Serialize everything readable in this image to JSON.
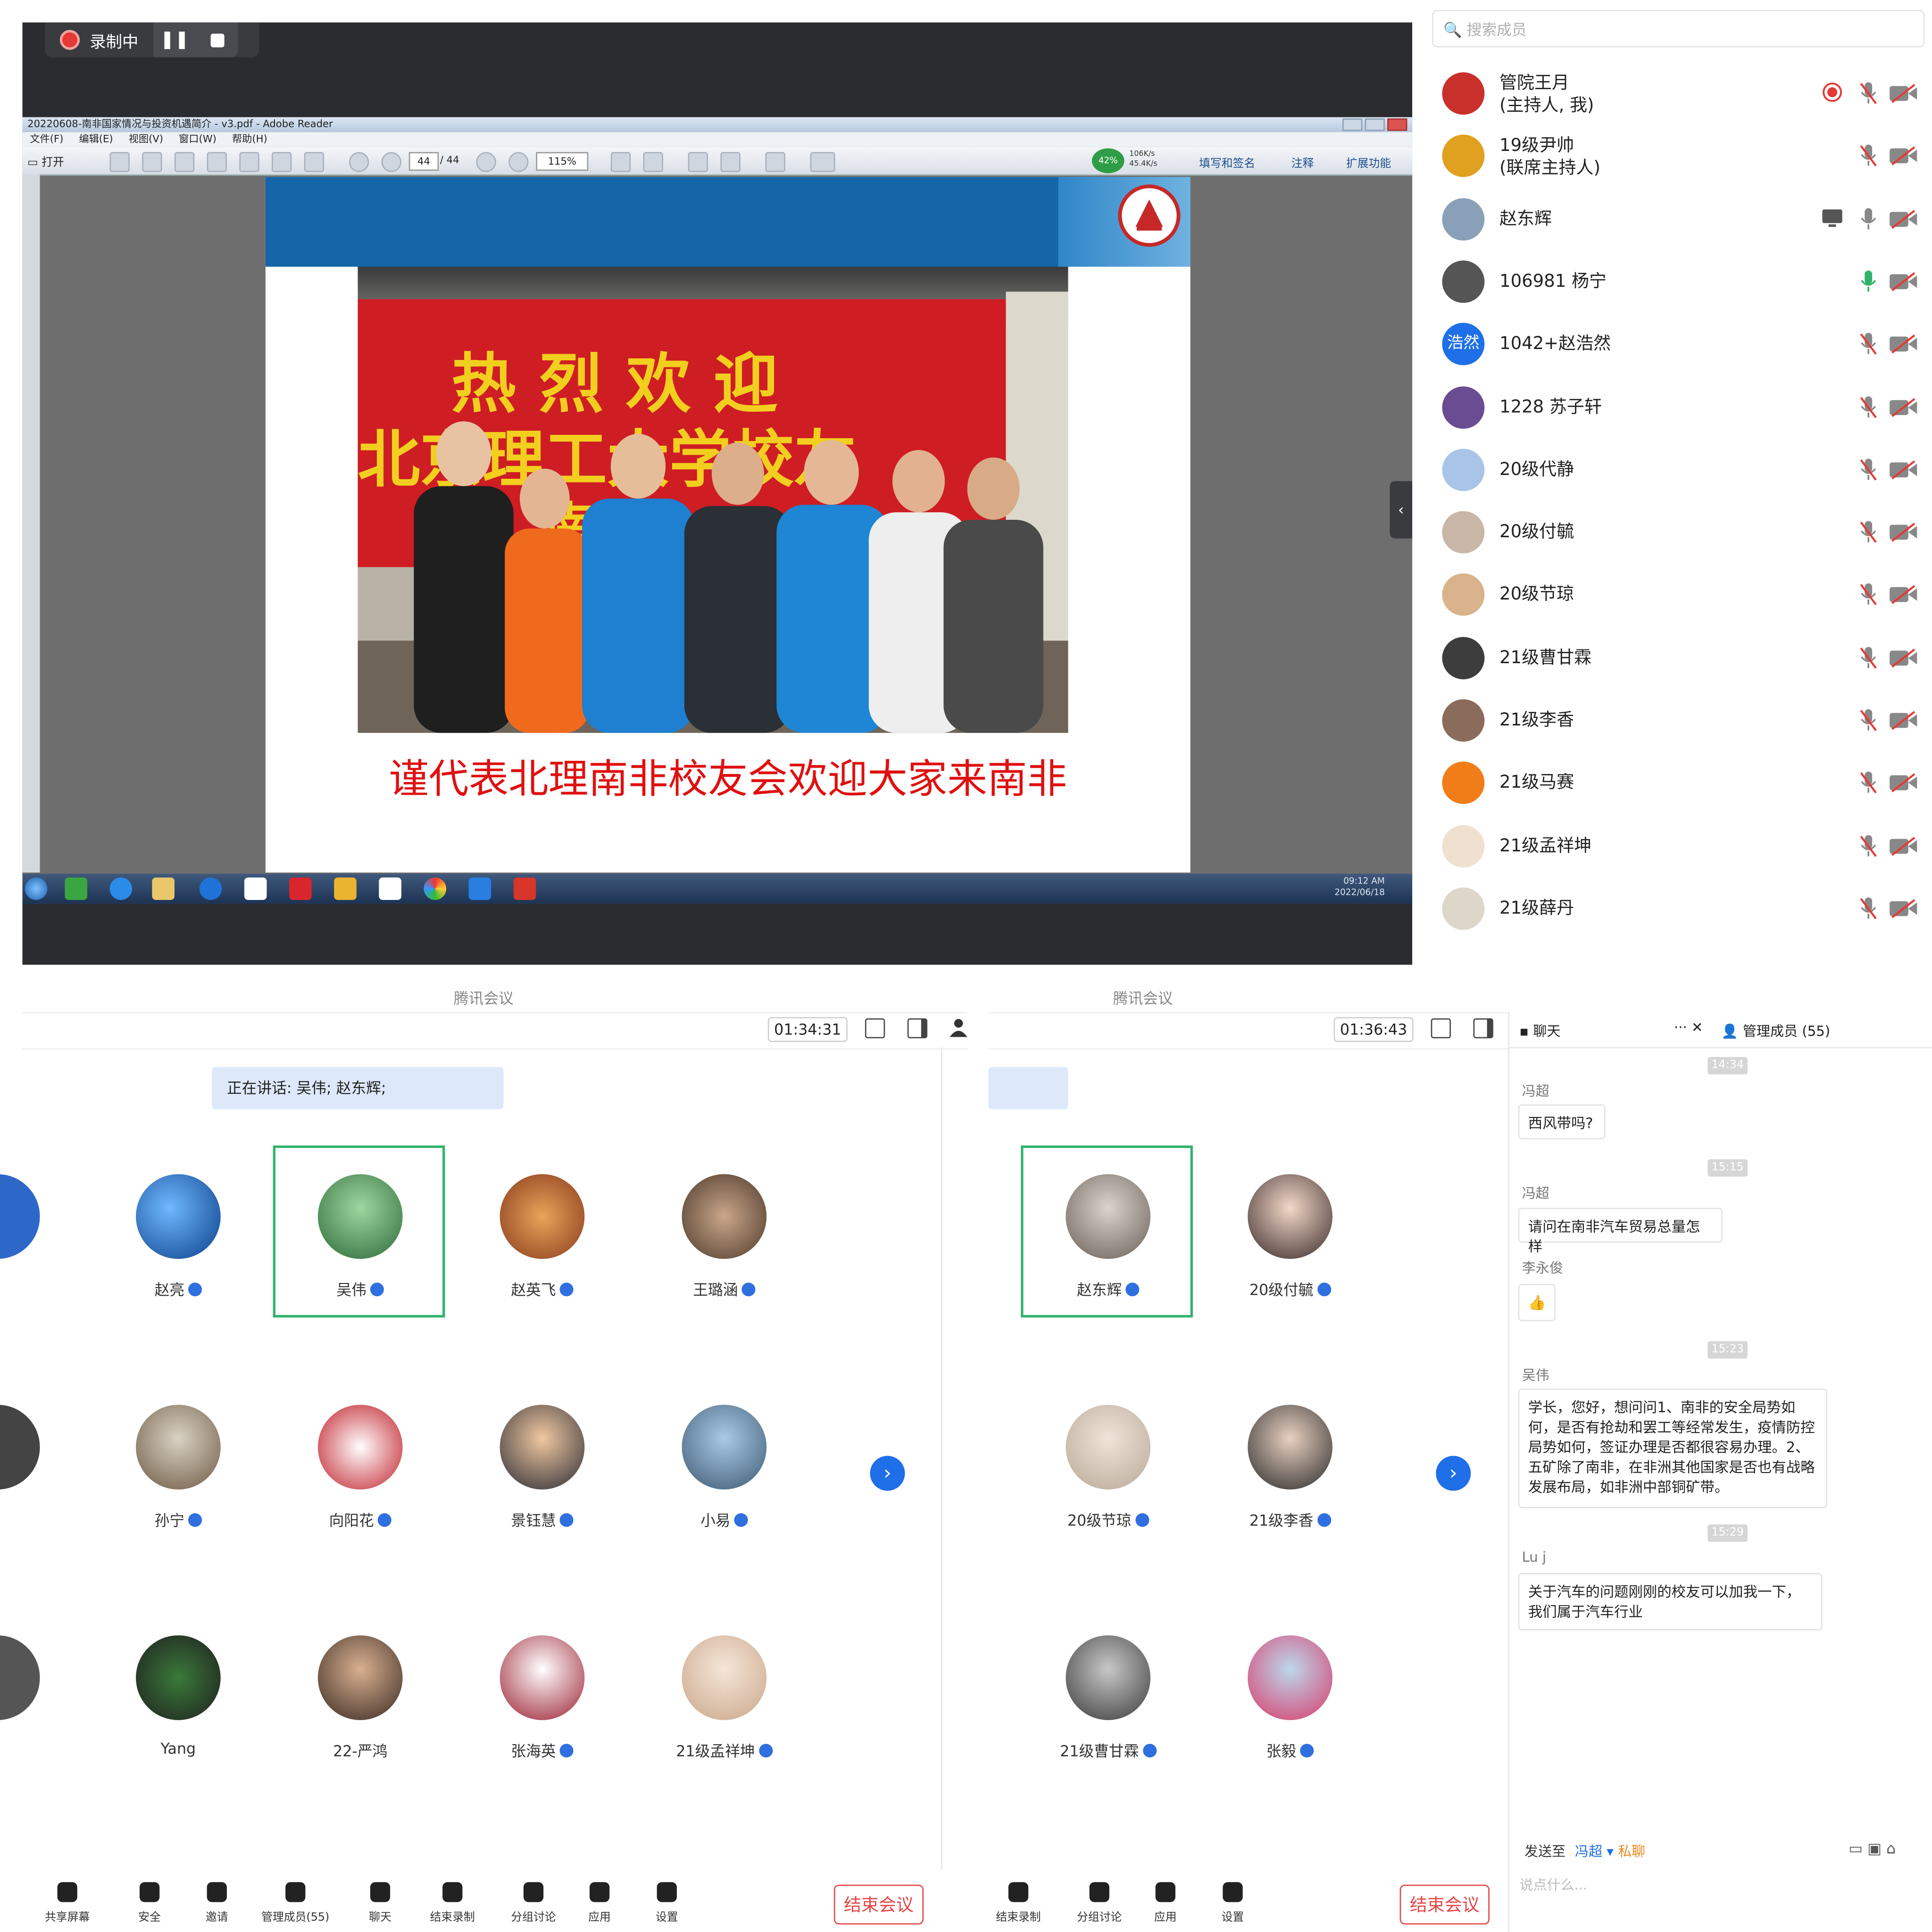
{
  "recording": {
    "label": "录制中",
    "pause_icon": "pause-icon",
    "stop_icon": "stop-icon"
  },
  "reader": {
    "window_title": "20220608-南非国家情况与投资机遇简介 - v3.pdf - Adobe Reader",
    "menu": [
      "文件(F)",
      "编辑(E)",
      "视图(V)",
      "窗口(W)",
      "帮助(H)"
    ],
    "open_label": "打开",
    "page_current": "44",
    "page_total": "/ 44",
    "zoom": "115%",
    "net_percent": "42%",
    "net_up": "106K/s",
    "net_down": "45.4K/s",
    "tool_links": [
      "填写和签名",
      "注释",
      "扩展功能"
    ],
    "clock_time": "09:12 AM",
    "clock_date": "2022/06/18"
  },
  "slide": {
    "banner_lines": [
      "热 烈 欢 迎",
      "北京理工大学校友",
      "南 非"
    ],
    "caption": "谨代表北理南非校友会欢迎大家来南非"
  },
  "members": {
    "search_placeholder": "搜索成员",
    "list": [
      {
        "name": "管院王月",
        "role": "(主持人, 我)",
        "status": "recording"
      },
      {
        "name": "19级尹帅",
        "role": "(联席主持人)",
        "status": "muted"
      },
      {
        "name": "赵东辉",
        "role": "",
        "status": "sharing"
      },
      {
        "name": "106981 杨宁",
        "role": "",
        "status": "speaking"
      },
      {
        "name": "1042+赵浩然",
        "role": "",
        "avatar_text": "浩然",
        "status": "muted"
      },
      {
        "name": "1228 苏子轩",
        "role": "",
        "status": "muted"
      },
      {
        "name": "20级代静",
        "role": "",
        "status": "muted"
      },
      {
        "name": "20级付毓",
        "role": "",
        "status": "muted"
      },
      {
        "name": "20级节琼",
        "role": "",
        "status": "muted"
      },
      {
        "name": "21级曹甘霖",
        "role": "",
        "status": "muted"
      },
      {
        "name": "21级李香",
        "role": "",
        "status": "muted"
      },
      {
        "name": "21级马赛",
        "role": "",
        "status": "muted"
      },
      {
        "name": "21级孟祥坤",
        "role": "",
        "status": "muted"
      },
      {
        "name": "21级薛丹",
        "role": "",
        "status": "muted"
      }
    ]
  },
  "left_meeting": {
    "app_title": "腾讯会议",
    "timer": "01:34:31",
    "speaking": "正在讲话: 吴伟; 赵东辉;",
    "tiles": [
      [
        "赵亮",
        "吴伟",
        "赵英飞",
        "王璐涵"
      ],
      [
        "孙宁",
        "向阳花",
        "景钰慧",
        "小易"
      ],
      [
        "Yang",
        "22-严鸿",
        "张海英",
        "21级孟祥坤"
      ]
    ],
    "toolbar": [
      "共享屏幕",
      "安全",
      "邀请",
      "管理成员(55)",
      "聊天",
      "结束录制",
      "分组讨论",
      "应用",
      "设置"
    ],
    "end_label": "结束会议"
  },
  "right_meeting": {
    "app_title": "腾讯会议",
    "timer": "01:36:43",
    "tiles": [
      [
        "赵东辉",
        "20级付毓"
      ],
      [
        "20级节琼",
        "21级李香"
      ],
      [
        "21级曹甘霖",
        "张毅"
      ]
    ],
    "toolbar": [
      "结束录制",
      "分组讨论",
      "应用",
      "设置"
    ],
    "end_label": "结束会议"
  },
  "chat": {
    "tab_chat": "聊天",
    "tab_members": "管理成员 (55)",
    "messages": [
      {
        "time": "14:34"
      },
      {
        "sender": "冯超",
        "text": "西风带吗?"
      },
      {
        "time": "15:15"
      },
      {
        "sender": "冯超",
        "text": "请问在南非汽车贸易总量怎样"
      },
      {
        "sender": "李永俊",
        "text": "👍"
      },
      {
        "time": "15:23"
      },
      {
        "sender": "吴伟",
        "text": "学长，您好，想问问1、南非的安全局势如何，是否有抢劫和罢工等经常发生，疫情防控局势如何，签证办理是否都很容易办理。2、五矿除了南非，在非洲其他国家是否也有战略发展布局，如非洲中部铜矿带。"
      },
      {
        "time": "15:29"
      },
      {
        "sender": "Lu j",
        "text": "关于汽车的问题刚刚的校友可以加我一下，我们属于汽车行业"
      }
    ],
    "send_to_label": "发送至",
    "send_to_target": "冯超",
    "private_label": "私聊",
    "input_placeholder": "说点什么..."
  },
  "colors": {
    "accent_blue": "#1e6fe8",
    "speaking_bg": "#dde9fb",
    "selected_frame": "#2fb36b",
    "end_red": "#e64545",
    "slide_red": "#e01010"
  }
}
